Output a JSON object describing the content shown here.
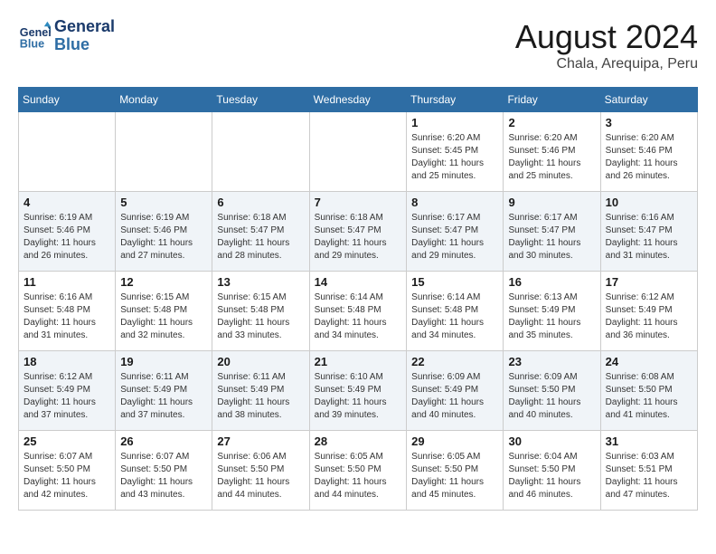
{
  "header": {
    "logo_line1": "General",
    "logo_line2": "Blue",
    "title": "August 2024",
    "subtitle": "Chala, Arequipa, Peru"
  },
  "weekdays": [
    "Sunday",
    "Monday",
    "Tuesday",
    "Wednesday",
    "Thursday",
    "Friday",
    "Saturday"
  ],
  "weeks": [
    [
      {
        "day": "",
        "details": ""
      },
      {
        "day": "",
        "details": ""
      },
      {
        "day": "",
        "details": ""
      },
      {
        "day": "",
        "details": ""
      },
      {
        "day": "1",
        "details": "Sunrise: 6:20 AM\nSunset: 5:45 PM\nDaylight: 11 hours\nand 25 minutes."
      },
      {
        "day": "2",
        "details": "Sunrise: 6:20 AM\nSunset: 5:46 PM\nDaylight: 11 hours\nand 25 minutes."
      },
      {
        "day": "3",
        "details": "Sunrise: 6:20 AM\nSunset: 5:46 PM\nDaylight: 11 hours\nand 26 minutes."
      }
    ],
    [
      {
        "day": "4",
        "details": "Sunrise: 6:19 AM\nSunset: 5:46 PM\nDaylight: 11 hours\nand 26 minutes."
      },
      {
        "day": "5",
        "details": "Sunrise: 6:19 AM\nSunset: 5:46 PM\nDaylight: 11 hours\nand 27 minutes."
      },
      {
        "day": "6",
        "details": "Sunrise: 6:18 AM\nSunset: 5:47 PM\nDaylight: 11 hours\nand 28 minutes."
      },
      {
        "day": "7",
        "details": "Sunrise: 6:18 AM\nSunset: 5:47 PM\nDaylight: 11 hours\nand 29 minutes."
      },
      {
        "day": "8",
        "details": "Sunrise: 6:17 AM\nSunset: 5:47 PM\nDaylight: 11 hours\nand 29 minutes."
      },
      {
        "day": "9",
        "details": "Sunrise: 6:17 AM\nSunset: 5:47 PM\nDaylight: 11 hours\nand 30 minutes."
      },
      {
        "day": "10",
        "details": "Sunrise: 6:16 AM\nSunset: 5:47 PM\nDaylight: 11 hours\nand 31 minutes."
      }
    ],
    [
      {
        "day": "11",
        "details": "Sunrise: 6:16 AM\nSunset: 5:48 PM\nDaylight: 11 hours\nand 31 minutes."
      },
      {
        "day": "12",
        "details": "Sunrise: 6:15 AM\nSunset: 5:48 PM\nDaylight: 11 hours\nand 32 minutes."
      },
      {
        "day": "13",
        "details": "Sunrise: 6:15 AM\nSunset: 5:48 PM\nDaylight: 11 hours\nand 33 minutes."
      },
      {
        "day": "14",
        "details": "Sunrise: 6:14 AM\nSunset: 5:48 PM\nDaylight: 11 hours\nand 34 minutes."
      },
      {
        "day": "15",
        "details": "Sunrise: 6:14 AM\nSunset: 5:48 PM\nDaylight: 11 hours\nand 34 minutes."
      },
      {
        "day": "16",
        "details": "Sunrise: 6:13 AM\nSunset: 5:49 PM\nDaylight: 11 hours\nand 35 minutes."
      },
      {
        "day": "17",
        "details": "Sunrise: 6:12 AM\nSunset: 5:49 PM\nDaylight: 11 hours\nand 36 minutes."
      }
    ],
    [
      {
        "day": "18",
        "details": "Sunrise: 6:12 AM\nSunset: 5:49 PM\nDaylight: 11 hours\nand 37 minutes."
      },
      {
        "day": "19",
        "details": "Sunrise: 6:11 AM\nSunset: 5:49 PM\nDaylight: 11 hours\nand 37 minutes."
      },
      {
        "day": "20",
        "details": "Sunrise: 6:11 AM\nSunset: 5:49 PM\nDaylight: 11 hours\nand 38 minutes."
      },
      {
        "day": "21",
        "details": "Sunrise: 6:10 AM\nSunset: 5:49 PM\nDaylight: 11 hours\nand 39 minutes."
      },
      {
        "day": "22",
        "details": "Sunrise: 6:09 AM\nSunset: 5:49 PM\nDaylight: 11 hours\nand 40 minutes."
      },
      {
        "day": "23",
        "details": "Sunrise: 6:09 AM\nSunset: 5:50 PM\nDaylight: 11 hours\nand 40 minutes."
      },
      {
        "day": "24",
        "details": "Sunrise: 6:08 AM\nSunset: 5:50 PM\nDaylight: 11 hours\nand 41 minutes."
      }
    ],
    [
      {
        "day": "25",
        "details": "Sunrise: 6:07 AM\nSunset: 5:50 PM\nDaylight: 11 hours\nand 42 minutes."
      },
      {
        "day": "26",
        "details": "Sunrise: 6:07 AM\nSunset: 5:50 PM\nDaylight: 11 hours\nand 43 minutes."
      },
      {
        "day": "27",
        "details": "Sunrise: 6:06 AM\nSunset: 5:50 PM\nDaylight: 11 hours\nand 44 minutes."
      },
      {
        "day": "28",
        "details": "Sunrise: 6:05 AM\nSunset: 5:50 PM\nDaylight: 11 hours\nand 44 minutes."
      },
      {
        "day": "29",
        "details": "Sunrise: 6:05 AM\nSunset: 5:50 PM\nDaylight: 11 hours\nand 45 minutes."
      },
      {
        "day": "30",
        "details": "Sunrise: 6:04 AM\nSunset: 5:50 PM\nDaylight: 11 hours\nand 46 minutes."
      },
      {
        "day": "31",
        "details": "Sunrise: 6:03 AM\nSunset: 5:51 PM\nDaylight: 11 hours\nand 47 minutes."
      }
    ]
  ]
}
